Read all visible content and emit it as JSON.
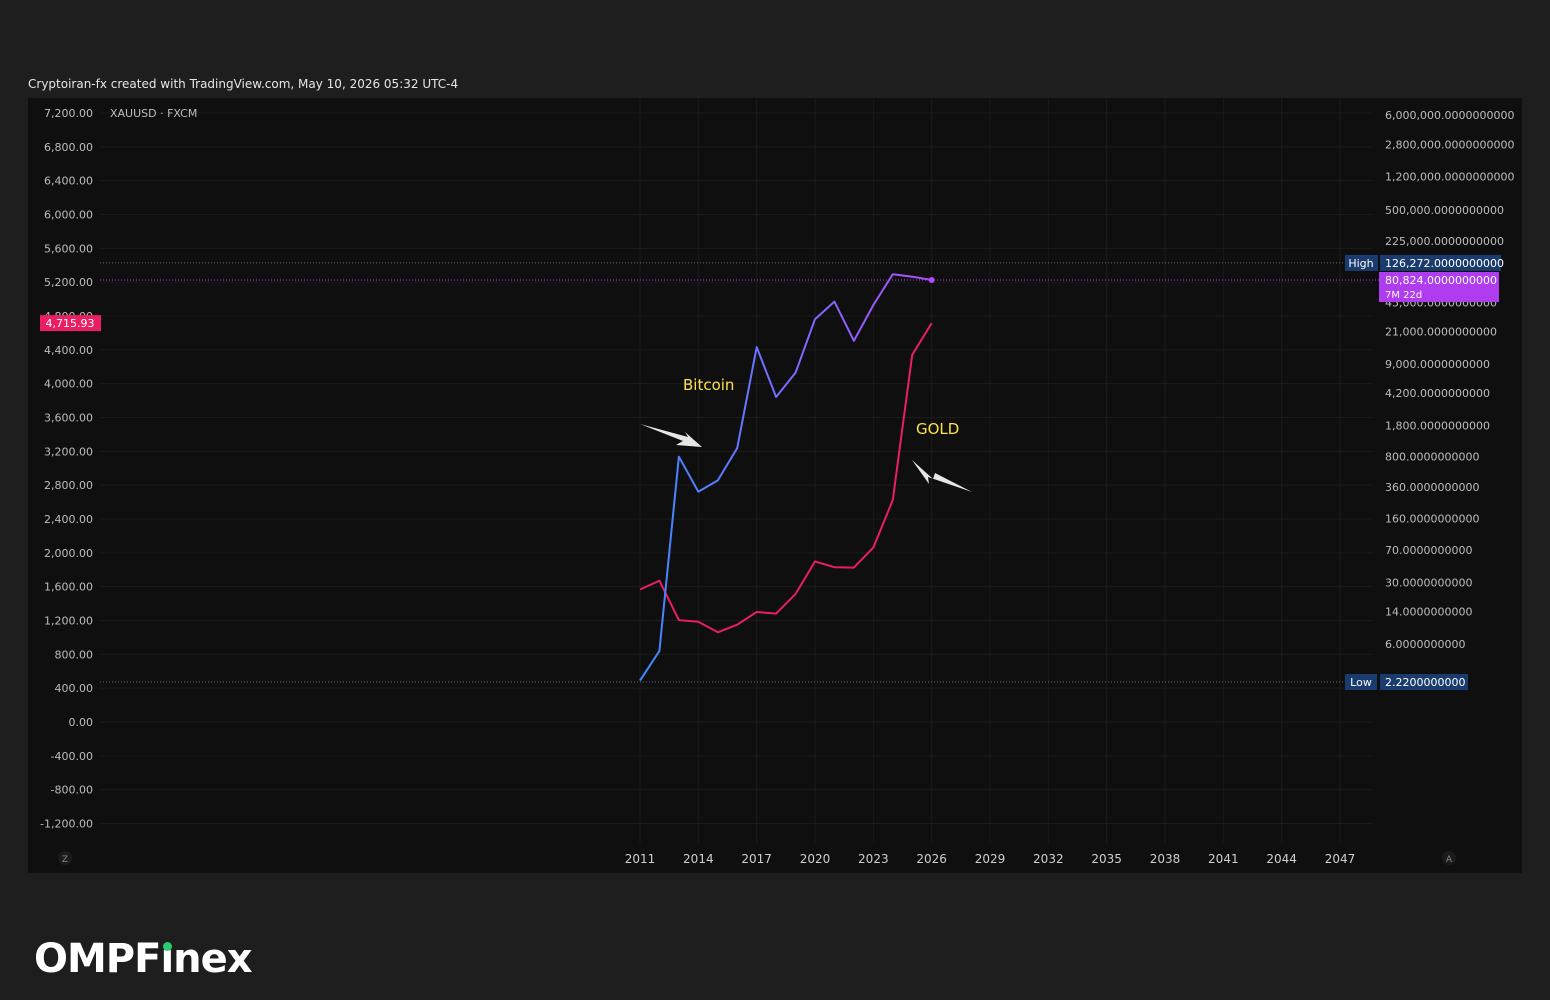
{
  "header": {
    "caption": "Cryptoiran-fx created with TradingView.com, May 10, 2026 05:32 UTC-4"
  },
  "brand": {
    "left": "OMPF",
    "i": "ı",
    "right": "nex",
    "accent": "#2ecc71"
  },
  "chart_data": {
    "type": "line",
    "symbol": "XAUUSD · FXCM",
    "x_ticks": [
      "2011",
      "2014",
      "2017",
      "2020",
      "2023",
      "2026",
      "2029",
      "2032",
      "2035",
      "2038",
      "2041",
      "2044",
      "2047"
    ],
    "x_range": [
      2011,
      2049
    ],
    "left_axis": {
      "ylim": [
        -1400,
        7250
      ],
      "ticks": [
        "7,200.00",
        "6,800.00",
        "6,400.00",
        "6,000.00",
        "5,600.00",
        "5,200.00",
        "4,800.00",
        "4,400.00",
        "4,000.00",
        "3,600.00",
        "3,200.00",
        "2,800.00",
        "2,400.00",
        "2,000.00",
        "1,600.00",
        "1,200.00",
        "800.00",
        "400.00",
        "0.00",
        "-400.00",
        "-800.00",
        "-1,200.00"
      ],
      "tick_values": [
        7200,
        6800,
        6400,
        6000,
        5600,
        5200,
        4800,
        4400,
        4000,
        3600,
        3200,
        2800,
        2400,
        2000,
        1600,
        1200,
        800,
        400,
        0,
        -400,
        -800,
        -1200
      ],
      "last_label": "4,715.93",
      "last_value": 4715.93,
      "last_color": "#e91e63"
    },
    "right_axis": {
      "scale": "log",
      "ticks": [
        "6,000,000.0000000000",
        "2,800,000.0000000000",
        "1,200,000.0000000000",
        "500,000.0000000000",
        "225,000.0000000000",
        "45,000.0000000000",
        "21,000.0000000000",
        "9,000.0000000000",
        "4,200.0000000000",
        "1,800.0000000000",
        "800.0000000000",
        "360.0000000000",
        "160.0000000000",
        "70.0000000000",
        "30.0000000000",
        "14.0000000000",
        "6.0000000000"
      ],
      "tick_values": [
        6000000,
        2800000,
        1200000,
        500000,
        225000,
        45000,
        21000,
        9000,
        4200,
        1800,
        800,
        360,
        160,
        70,
        30,
        14,
        6
      ],
      "high": {
        "label": "High",
        "value_text": "126,272.0000000000",
        "value": 126272
      },
      "low": {
        "label": "Low",
        "value_text": "2.2200000000",
        "value": 2.22
      },
      "last": {
        "value_text": "80,824.0000000000",
        "countdown": "7M 22d",
        "value": 80824,
        "color": "#b03cf0"
      }
    },
    "series": [
      {
        "name": "Bitcoin",
        "axis": "right",
        "color_start": "#3d8bff",
        "color_end": "#b04cff",
        "x": [
          2011,
          2012,
          2013,
          2014,
          2015,
          2016,
          2017,
          2018,
          2019,
          2020,
          2021,
          2022,
          2023,
          2024,
          2025,
          2026
        ],
        "values": [
          2.3,
          5,
          800,
          320,
          430,
          1000,
          14000,
          3800,
          7200,
          29000,
          46000,
          16500,
          42000,
          94000,
          88000,
          80824
        ]
      },
      {
        "name": "GOLD",
        "axis": "left",
        "color": "#e91e63",
        "x": [
          2011,
          2012,
          2013,
          2014,
          2015,
          2016,
          2017,
          2018,
          2019,
          2020,
          2021,
          2022,
          2023,
          2024,
          2025,
          2026
        ],
        "values": [
          1566,
          1670,
          1205,
          1185,
          1060,
          1150,
          1300,
          1282,
          1515,
          1898,
          1830,
          1825,
          2062,
          2625,
          4340,
          4716
        ]
      }
    ],
    "annotations": [
      {
        "text": "Bitcoin",
        "color": "#ffe14d"
      },
      {
        "text": "GOLD",
        "color": "#ffe14d"
      }
    ],
    "corner_left": "Z",
    "corner_right": "A",
    "grid": true
  }
}
